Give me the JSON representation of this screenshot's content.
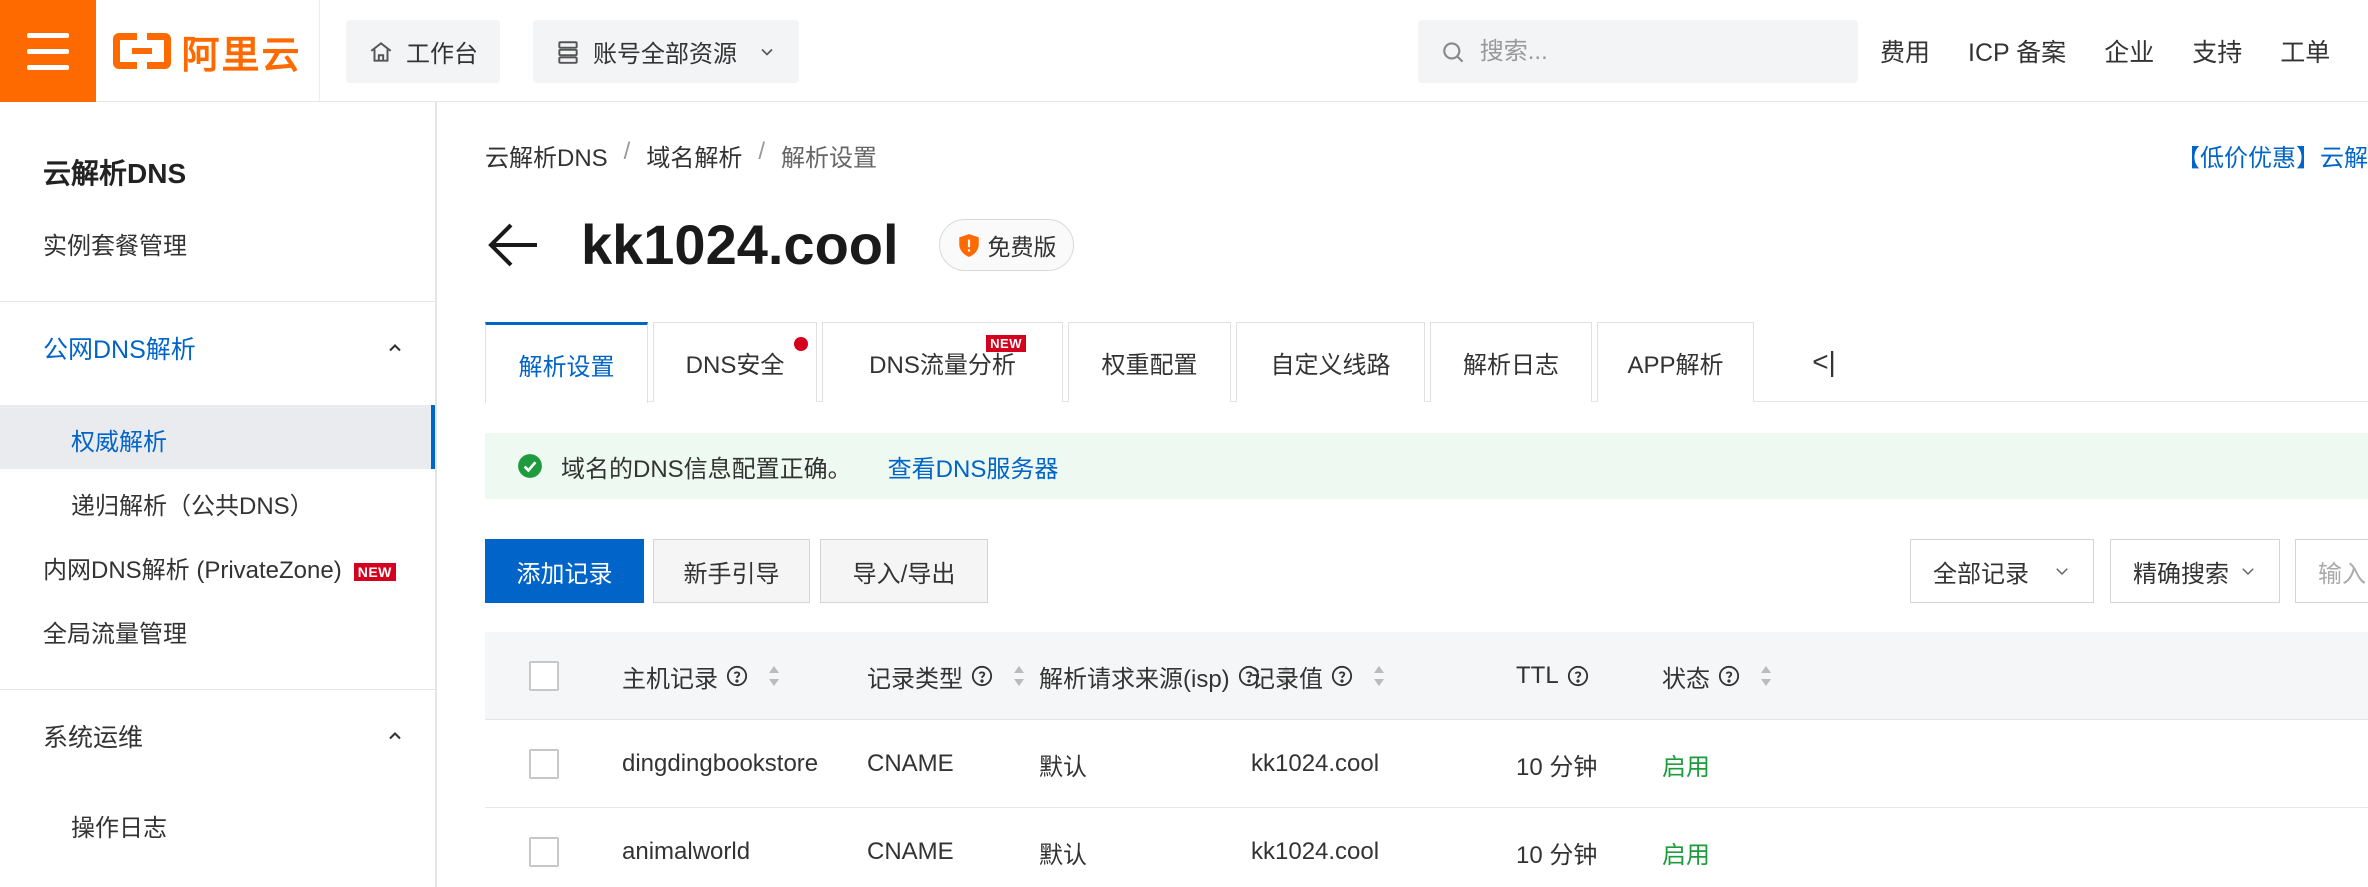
{
  "header": {
    "logo_text": "阿里云",
    "workbench_label": "工作台",
    "resources_label": "账号全部资源",
    "search_placeholder": "搜索...",
    "links": [
      "费用",
      "ICP 备案",
      "企业",
      "支持",
      "工单"
    ]
  },
  "sidebar": {
    "title": "云解析DNS",
    "instance_mgmt": "实例套餐管理",
    "group_public": "公网DNS解析",
    "auth_resolve": "权威解析",
    "recursive_resolve": "递归解析（公共DNS）",
    "private_zone": "内网DNS解析 (PrivateZone)",
    "new_badge": "NEW",
    "global_traffic": "全局流量管理",
    "group_ops": "系统运维",
    "op_log": "操作日志"
  },
  "breadcrumb": [
    "云解析DNS",
    "域名解析",
    "解析设置"
  ],
  "breadcrumb_sep": "/",
  "promo_text": "【低价优惠】云解",
  "domain": {
    "name": "kk1024.cool",
    "plan": "免费版"
  },
  "tabs": [
    {
      "label": "解析设置"
    },
    {
      "label": "DNS安全"
    },
    {
      "label": "DNS流量分析",
      "tag": "NEW"
    },
    {
      "label": "权重配置"
    },
    {
      "label": "自定义线路"
    },
    {
      "label": "解析日志"
    },
    {
      "label": "APP解析"
    }
  ],
  "tab_scroll": "<|",
  "alert": {
    "message": "域名的DNS信息配置正确。",
    "link": "查看DNS服务器"
  },
  "toolbar": {
    "add_record": "添加记录",
    "guide": "新手引导",
    "import_export": "导入/导出",
    "filter_all": "全部记录",
    "exact_search": "精确搜索",
    "input_placeholder": "输入"
  },
  "table": {
    "headers": [
      "主机记录",
      "记录类型",
      "解析请求来源(isp)",
      "记录值",
      "TTL",
      "状态"
    ],
    "rows": [
      {
        "host": "dingdingbookstore",
        "type": "CNAME",
        "isp": "默认",
        "value": "kk1024.cool",
        "ttl": "10 分钟",
        "status": "启用"
      },
      {
        "host": "animalworld",
        "type": "CNAME",
        "isp": "默认",
        "value": "kk1024.cool",
        "ttl": "10 分钟",
        "status": "启用"
      }
    ]
  },
  "colors": {
    "brand": "#ff6a00",
    "accent": "#0064c8",
    "success": "#1e9b3c",
    "badge_red": "#d4001d"
  }
}
